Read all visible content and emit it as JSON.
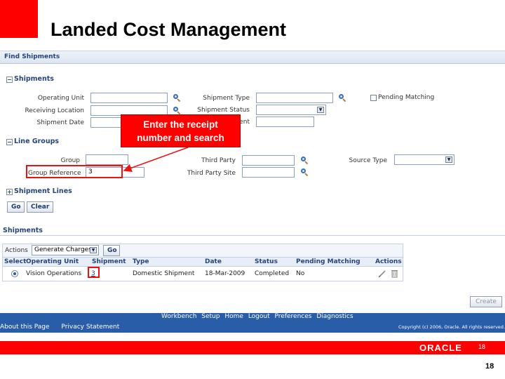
{
  "slide": {
    "title": "Landed Cost Management",
    "page_number": "18",
    "bar_page_number": "18",
    "logo_text": "ORACLE",
    "accent_color": "#ff0000"
  },
  "find": {
    "header": "Find Shipments",
    "shipments_section": "Shipments",
    "operating_unit_label": "Operating Unit",
    "receiving_location_label": "Receiving Location",
    "shipment_date_label": "Shipment Date",
    "shipment_type_label": "Shipment Type",
    "shipment_status_label": "Shipment Status",
    "hidden_label_fragment": "ent",
    "pending_matching_label": "Pending Matching",
    "line_groups_section": "Line Groups",
    "group_label": "Group",
    "group_reference_label": "Group Reference",
    "group_reference_value": "3",
    "third_party_label": "Third Party",
    "third_party_site_label": "Third Party Site",
    "source_type_label": "Source Type",
    "shipment_lines_section": "Shipment Lines",
    "go_label": "Go",
    "clear_label": "Clear"
  },
  "results": {
    "title": "Shipments",
    "actions_label": "Actions",
    "action_selected": "Generate Charges",
    "go_label": "Go",
    "columns": [
      "Select",
      "Operating Unit",
      "Shipment",
      "Type",
      "Date",
      "Status",
      "Pending Matching",
      "Actions"
    ],
    "row": {
      "operating_unit": "Vision Operations",
      "shipment": "3",
      "type": "Domestic Shipment",
      "date": "18-Mar-2009",
      "status": "Completed",
      "pending_matching": "No"
    },
    "create_label": "Create"
  },
  "footer": {
    "links": [
      "Workbench",
      "Setup",
      "Home",
      "Logout",
      "Preferences",
      "Diagnostics"
    ],
    "left_links": [
      "About this Page",
      "Privacy Statement"
    ],
    "copyright": "Copyright (c) 2006, Oracle. All rights reserved."
  },
  "callout": {
    "text": "Enter the receipt\nnumber and search"
  }
}
